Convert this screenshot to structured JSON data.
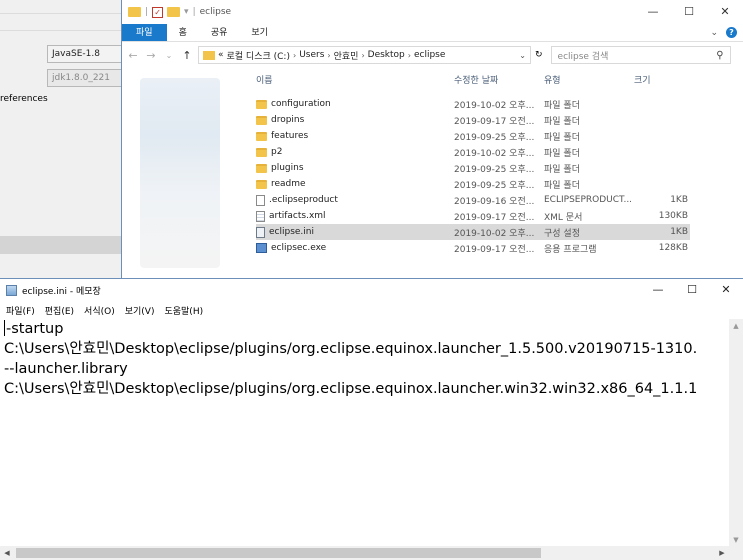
{
  "background_window": {
    "field_java": "JavaSE-1.8",
    "field_jdk": "jdk1.8.0_221",
    "label_references": "references"
  },
  "explorer": {
    "title": "eclipse",
    "ribbon_tabs": [
      "파일",
      "홈",
      "공유",
      "보기"
    ],
    "address": {
      "prefix": "«",
      "crumbs": [
        "로컬 디스크 (C:)",
        "Users",
        "안효민",
        "Desktop",
        "eclipse"
      ]
    },
    "search_placeholder": "eclipse 검색",
    "columns": {
      "name": "이름",
      "date": "수정한 날짜",
      "type": "유형",
      "size": "크기"
    },
    "files": [
      {
        "name": "configuration",
        "date": "2019-10-02 오후...",
        "type": "파일 폴더",
        "size": "",
        "icon": "folder-icon"
      },
      {
        "name": "dropins",
        "date": "2019-09-17 오전...",
        "type": "파일 폴더",
        "size": "",
        "icon": "folder-icon"
      },
      {
        "name": "features",
        "date": "2019-09-25 오후...",
        "type": "파일 폴더",
        "size": "",
        "icon": "folder-icon"
      },
      {
        "name": "p2",
        "date": "2019-10-02 오후...",
        "type": "파일 폴더",
        "size": "",
        "icon": "folder-icon"
      },
      {
        "name": "plugins",
        "date": "2019-09-25 오후...",
        "type": "파일 폴더",
        "size": "",
        "icon": "folder-icon"
      },
      {
        "name": "readme",
        "date": "2019-09-25 오후...",
        "type": "파일 폴더",
        "size": "",
        "icon": "folder-icon"
      },
      {
        "name": ".eclipseproduct",
        "date": "2019-09-16 오전...",
        "type": "ECLIPSEPRODUCT...",
        "size": "1KB",
        "icon": "file-icon"
      },
      {
        "name": "artifacts.xml",
        "date": "2019-09-17 오전...",
        "type": "XML 문서",
        "size": "130KB",
        "icon": "xml-icon"
      },
      {
        "name": "eclipse.ini",
        "date": "2019-10-02 오후...",
        "type": "구성 설정",
        "size": "1KB",
        "icon": "ini-icon",
        "selected": true
      },
      {
        "name": "eclipsec.exe",
        "date": "2019-09-17 오전...",
        "type": "응용 프로그램",
        "size": "128KB",
        "icon": "exe-icon"
      }
    ]
  },
  "notepad": {
    "title": "eclipse.ini - 메모장",
    "menu": [
      "파일(F)",
      "편집(E)",
      "서식(O)",
      "보기(V)",
      "도움말(H)"
    ],
    "lines": [
      "-startup",
      "C:\\Users\\안효민\\Desktop\\eclipse/plugins/org.eclipse.equinox.launcher_1.5.500.v20190715-1310.",
      "--launcher.library",
      "C:\\Users\\안효민\\Desktop\\eclipse/plugins/org.eclipse.equinox.launcher.win32.win32.x86_64_1.1.1"
    ]
  }
}
